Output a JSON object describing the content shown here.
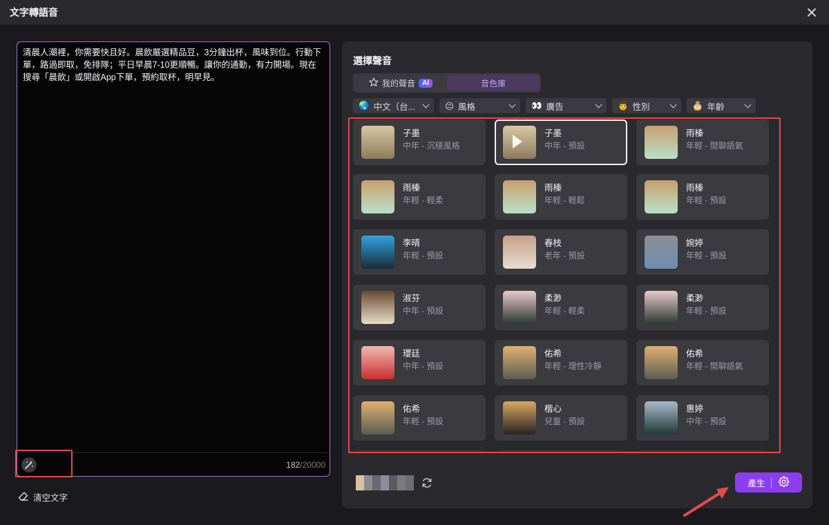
{
  "window": {
    "title": "文字轉語音"
  },
  "editor": {
    "text": "清晨人潮裡，你需要快且好。晨飲嚴選精品豆，3分鐘出杯，風味到位。行動下單，路過即取，免排隊；平日早晨7-10更順暢。讓你的通勤，有力開場。現在搜尋「晨飲」或開啟App下單，預約取杯，明早見。",
    "count": "182",
    "max": "/20000"
  },
  "clear_text_label": "清空文字",
  "voice_panel": {
    "title": "選擇聲音",
    "tabs": [
      {
        "label": "我的聲音",
        "badge": "AI"
      },
      {
        "label": "音色庫"
      }
    ],
    "filters": [
      {
        "label": "中文（台...",
        "icon": "globe-icon"
      },
      {
        "label": "風格",
        "icon": "smile-icon"
      },
      {
        "label": "廣告",
        "icon": "eyes-icon"
      },
      {
        "label": "性別",
        "icon": "person-icon"
      },
      {
        "label": "年齡",
        "icon": "cake-icon"
      }
    ],
    "voices": [
      {
        "name": "子墨",
        "desc": "中年 - 沉穩風格"
      },
      {
        "name": "子墨",
        "desc": "中年 - 預設"
      },
      {
        "name": "雨榛",
        "desc": "年輕 - 閒聊語氣"
      },
      {
        "name": "雨榛",
        "desc": "年輕 - 輕柔"
      },
      {
        "name": "雨榛",
        "desc": "年輕 - 輕鬆"
      },
      {
        "name": "雨榛",
        "desc": "年輕 - 預設"
      },
      {
        "name": "李晴",
        "desc": "年輕 - 預設"
      },
      {
        "name": "春枝",
        "desc": "老年 - 預設"
      },
      {
        "name": "婉婷",
        "desc": "年輕 - 預設"
      },
      {
        "name": "淑芬",
        "desc": "中年 - 預設"
      },
      {
        "name": "柔渺",
        "desc": "年輕 - 輕柔"
      },
      {
        "name": "柔渺",
        "desc": "年輕 - 預設"
      },
      {
        "name": "瓔廷",
        "desc": "中年 - 預設"
      },
      {
        "name": "佑希",
        "desc": "年輕 - 理性冷靜"
      },
      {
        "name": "佑希",
        "desc": "年輕 - 閒聊語氣"
      },
      {
        "name": "佑希",
        "desc": "年輕 - 預設"
      },
      {
        "name": "楷心",
        "desc": "兒童 - 預設"
      },
      {
        "name": "惠婷",
        "desc": "中年 - 預設"
      }
    ]
  },
  "generate_label": "產生",
  "colors": {
    "accent": "#8a3ef0",
    "highlight": "#e24c4b"
  }
}
